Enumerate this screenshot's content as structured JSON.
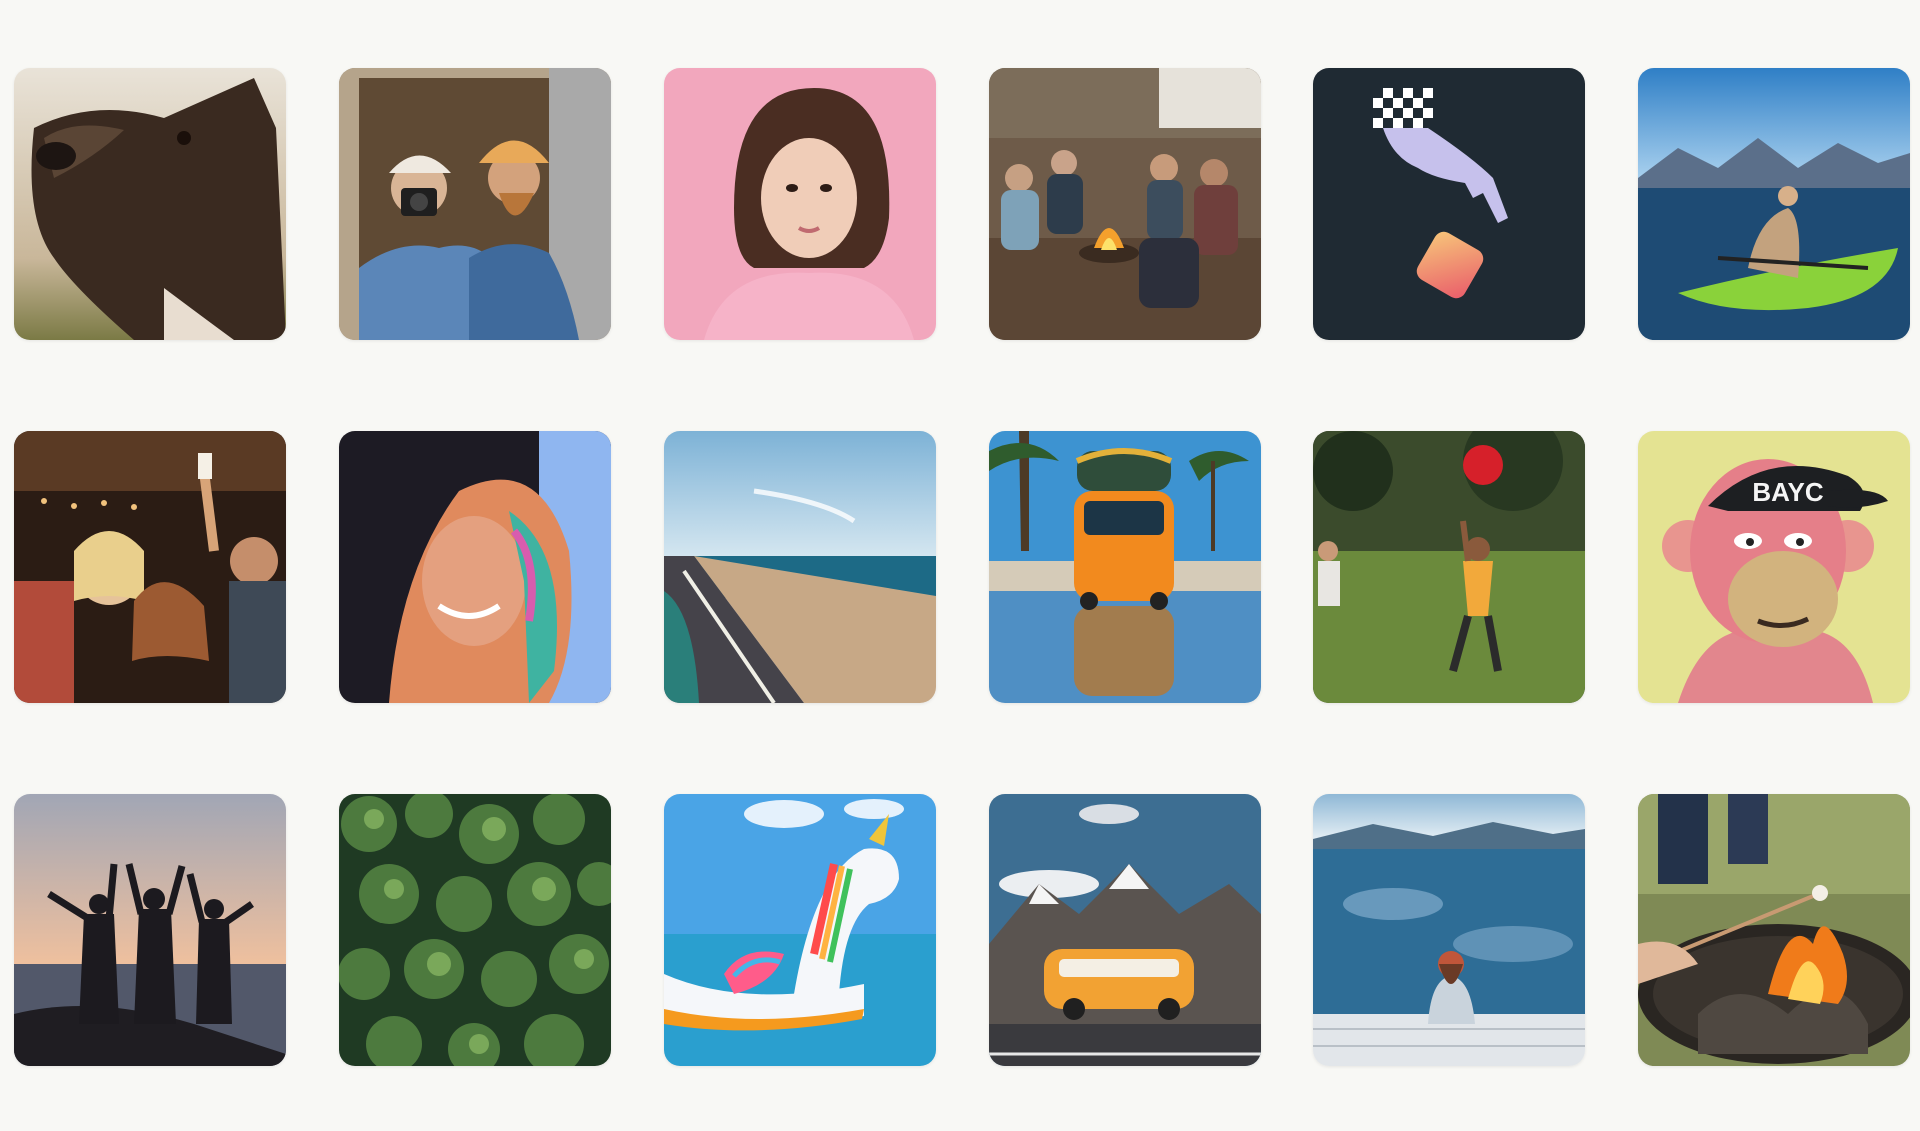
{
  "gallery": {
    "columns": 6,
    "rows": 3,
    "tiles": [
      {
        "id": "dog",
        "subject": "dog"
      },
      {
        "id": "mirror",
        "subject": "couple-camera"
      },
      {
        "id": "portrait-pink",
        "subject": "portrait"
      },
      {
        "id": "campfire-group",
        "subject": "campfire"
      },
      {
        "id": "hand-nft",
        "subject": "hand-logo"
      },
      {
        "id": "kayak",
        "subject": "kayak"
      },
      {
        "id": "party",
        "subject": "party"
      },
      {
        "id": "portrait-neon",
        "subject": "portrait-neon"
      },
      {
        "id": "coastal-road",
        "subject": "road"
      },
      {
        "id": "vw-van-beach",
        "subject": "van-beach"
      },
      {
        "id": "kids-ball",
        "subject": "kids-ball"
      },
      {
        "id": "ape-nft",
        "subject": "ape"
      },
      {
        "id": "sunset-friends",
        "subject": "sunset"
      },
      {
        "id": "forest-aerial",
        "subject": "forest"
      },
      {
        "id": "unicorn-float",
        "subject": "unicorn"
      },
      {
        "id": "van-mountains",
        "subject": "van-mountains"
      },
      {
        "id": "lake-reflection",
        "subject": "lake"
      },
      {
        "id": "firepit",
        "subject": "firepit"
      }
    ]
  },
  "theme": {
    "background": "#f8f8f5"
  },
  "overlay_text": {
    "ape_cap": "BAYC"
  }
}
